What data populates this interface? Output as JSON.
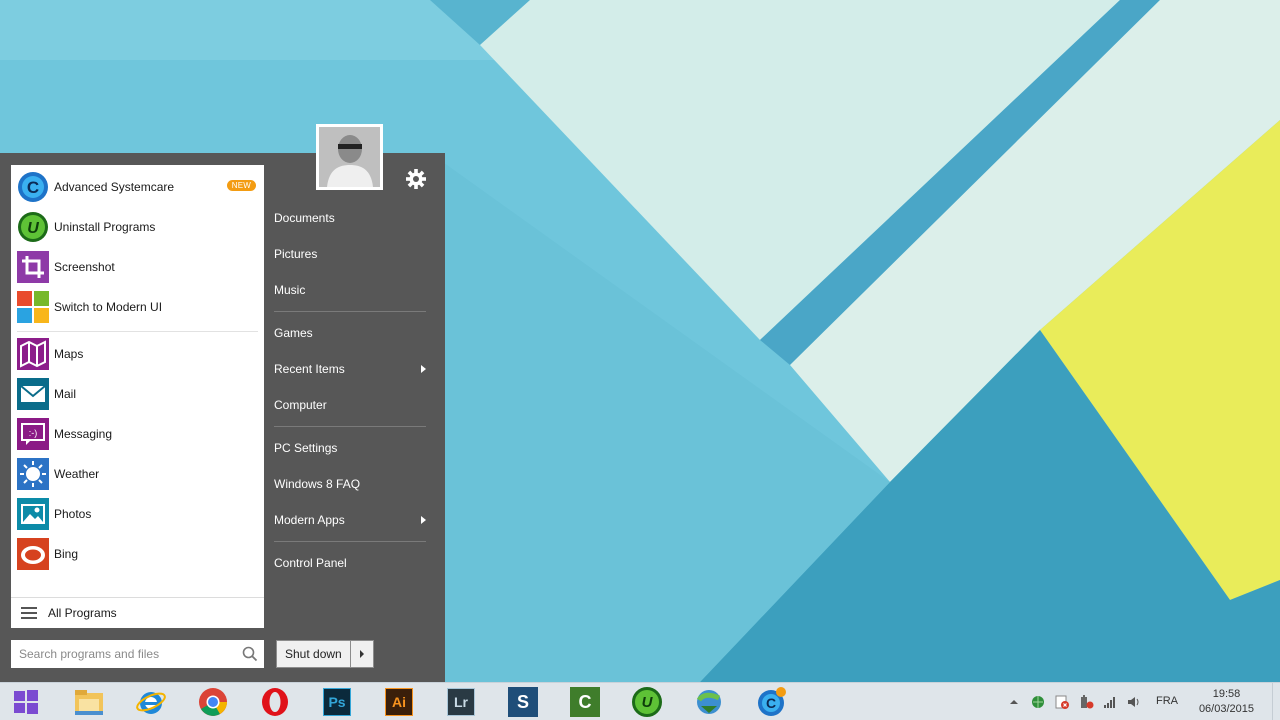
{
  "start_menu": {
    "pinned": [
      {
        "label": "Advanced Systemcare",
        "icon": "advanced-systemcare-icon",
        "badge": "NEW"
      },
      {
        "label": "Uninstall Programs",
        "icon": "iobit-uninstaller-icon"
      },
      {
        "label": "Screenshot",
        "icon": "crop-icon"
      },
      {
        "label": "Switch to Modern UI",
        "icon": "windows-tiles-icon"
      }
    ],
    "apps": [
      {
        "label": "Maps",
        "icon": "maps-icon"
      },
      {
        "label": "Mail",
        "icon": "mail-icon"
      },
      {
        "label": "Messaging",
        "icon": "messaging-icon"
      },
      {
        "label": "Weather",
        "icon": "weather-icon"
      },
      {
        "label": "Photos",
        "icon": "photos-icon"
      },
      {
        "label": "Bing",
        "icon": "bing-icon"
      }
    ],
    "all_programs": "All Programs",
    "search_placeholder": "Search programs and files",
    "shutdown_label": "Shut down",
    "right_items": [
      {
        "label": "Documents"
      },
      {
        "label": "Pictures"
      },
      {
        "label": "Music"
      },
      {
        "label": "Games"
      },
      {
        "label": "Recent Items",
        "submenu": true
      },
      {
        "label": "Computer"
      },
      {
        "label": "PC Settings"
      },
      {
        "label": "Windows 8 FAQ"
      },
      {
        "label": "Modern Apps",
        "submenu": true
      },
      {
        "label": "Control Panel"
      }
    ]
  },
  "taskbar": {
    "apps": [
      "start-icon",
      "file-explorer-icon",
      "internet-explorer-icon",
      "chrome-icon",
      "opera-icon",
      "photoshop-icon",
      "illustrator-icon",
      "lightroom-icon",
      "snagit-icon",
      "camtasia-icon",
      "iobit-uninstaller-icon",
      "download-manager-icon",
      "advanced-systemcare-icon"
    ],
    "app_labels": {
      "ps": "Ps",
      "ai": "Ai",
      "lr": "Lr",
      "snagit": "S",
      "camtasia": "C",
      "iobit": "U"
    },
    "language": "FRA",
    "time": "19:58",
    "date": "06/03/2015"
  },
  "colors": {
    "menu_bg": "#575757",
    "accent_orange": "#f39c12",
    "wallpaper_light": "#d3ede9",
    "wallpaper_blue": "#6fc6dc",
    "wallpaper_yellow": "#e9ec5a"
  }
}
